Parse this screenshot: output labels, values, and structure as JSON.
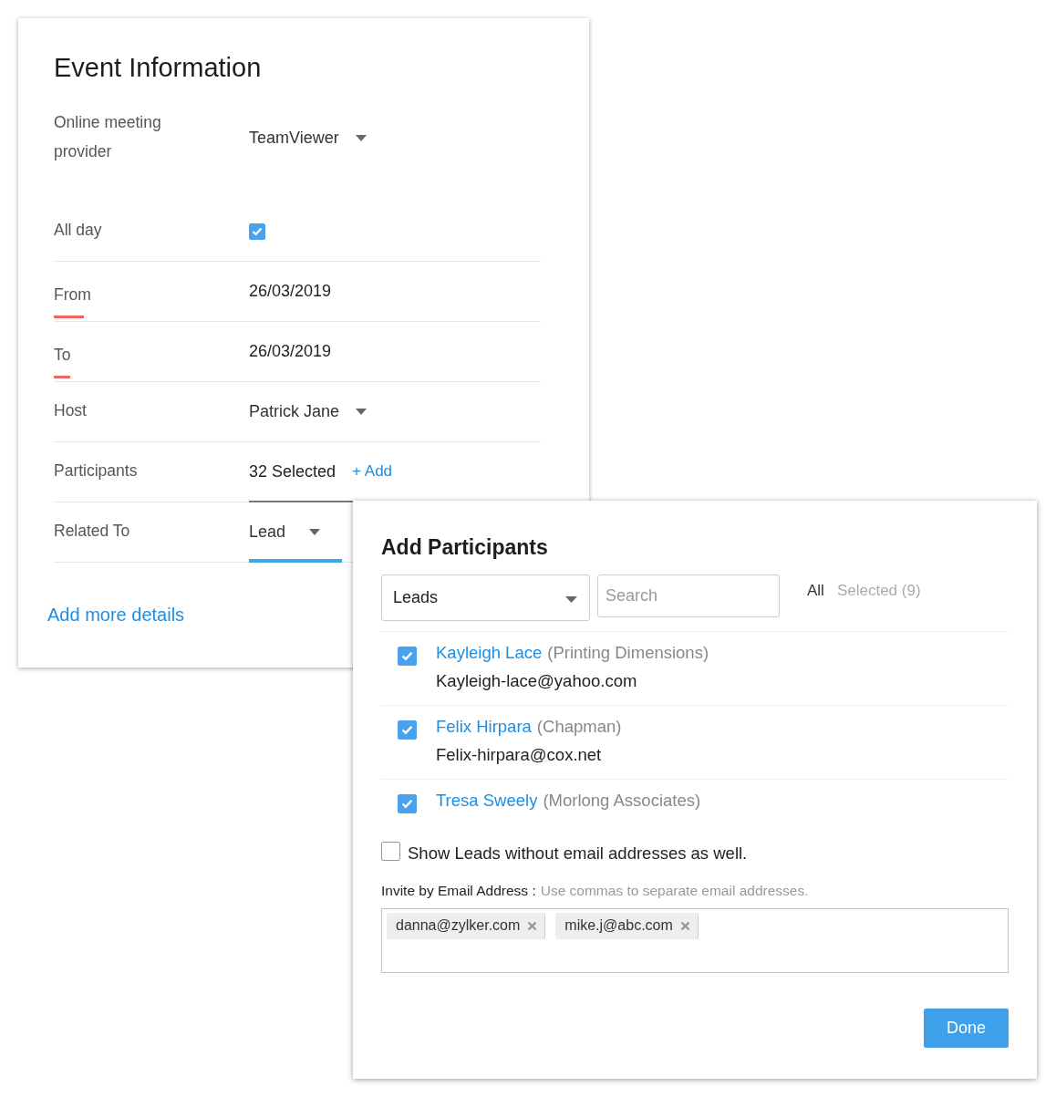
{
  "event_card": {
    "title": "Event Information",
    "fields": [
      {
        "kind": "dropdown",
        "label": "Online meeting provider",
        "value": "TeamViewer",
        "required": false,
        "focused": false
      },
      {
        "kind": "checkbox",
        "label": "All day",
        "checked": true,
        "required": false,
        "focused": false
      },
      {
        "kind": "text",
        "label": "From",
        "value": "26/03/2019",
        "required": true,
        "focused": false
      },
      {
        "kind": "text",
        "label": "To",
        "value": "26/03/2019",
        "required": true,
        "focused": false
      },
      {
        "kind": "dropdown",
        "label": "Host",
        "value": "Patrick Jane",
        "required": false,
        "focused": false
      },
      {
        "kind": "participants",
        "label": "Participants",
        "value": "32 Selected",
        "action": "+ Add",
        "required": false,
        "focused": false
      },
      {
        "kind": "dropdown",
        "label": "Related To",
        "value": "Lead",
        "required": false,
        "focused": true
      }
    ],
    "link": "Add more details"
  },
  "dialog": {
    "title": "Add Participants",
    "module_select": "Leads",
    "search": {
      "placeholder": "Search"
    },
    "tabs": [
      {
        "label": "All",
        "selected": true
      },
      {
        "label": "Selected (9)",
        "selected": false
      }
    ],
    "participants": [
      {
        "name": "Kayleigh Lace",
        "company": "(Printing Dimensions)",
        "email": "Kayleigh-lace@yahoo.com",
        "checked": true
      },
      {
        "name": "Felix Hirpara",
        "company": "(Chapman)",
        "email": "Felix-hirpara@cox.net",
        "checked": true
      },
      {
        "name": "Tresa Sweely",
        "company": "(Morlong Associates)",
        "checked": true
      }
    ],
    "show_without_email": {
      "label": "Show Leads without email addresses as well.",
      "checked": false
    },
    "invite_label": "Invite by Email Address :",
    "invite_hint": "Use commas to separate email addresses.",
    "emails": [
      "danna@zylker.com",
      "mike.j@abc.com"
    ],
    "done": "Done"
  }
}
